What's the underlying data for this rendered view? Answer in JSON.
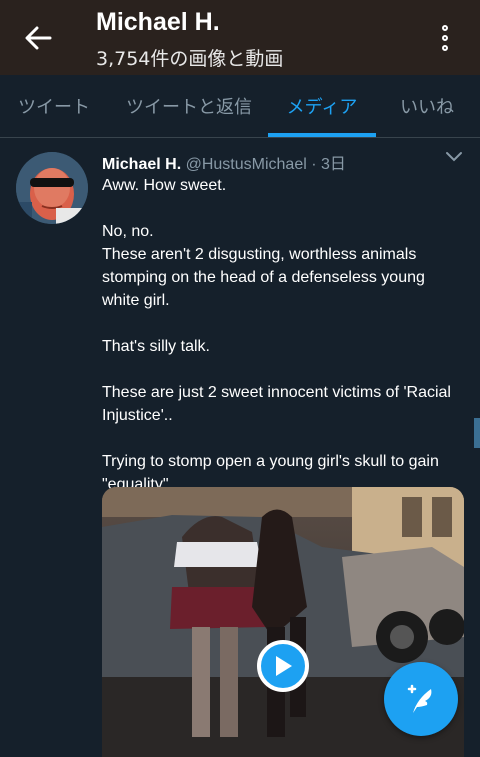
{
  "header": {
    "title": "Michael H.",
    "subtitle": "3,754件の画像と動画",
    "back_icon": "arrow-left-icon",
    "more_icon": "more-vertical-icon"
  },
  "tabs": [
    {
      "label": "ツイート",
      "active": false
    },
    {
      "label": "ツイートと返信",
      "active": false
    },
    {
      "label": "メディア",
      "active": true
    },
    {
      "label": "いいね",
      "active": false
    }
  ],
  "tweet": {
    "name": "Michael H.",
    "handle": "@HustusMichael",
    "separator": "·",
    "time": "3日",
    "paragraphs": [
      [
        "Aww.  How sweet."
      ],
      [
        "No, no.",
        "These aren't 2 disgusting, worthless animals",
        "stomping on the head of a defenseless young",
        "white girl."
      ],
      [
        "That's silly talk."
      ],
      [
        "These are just 2 sweet innocent victims of 'Racial",
        "Injustice'.."
      ],
      [
        "Trying to stomp open a young girl's skull to gain",
        "\"equality\".."
      ]
    ],
    "media": {
      "type": "video",
      "play_icon": "play-icon"
    }
  },
  "fab": {
    "icon": "compose-tweet-icon"
  },
  "colors": {
    "background": "#15202b",
    "topbar": "#2a221e",
    "accent": "#1da1f2",
    "muted": "#8899a6",
    "divider": "#38444d"
  }
}
